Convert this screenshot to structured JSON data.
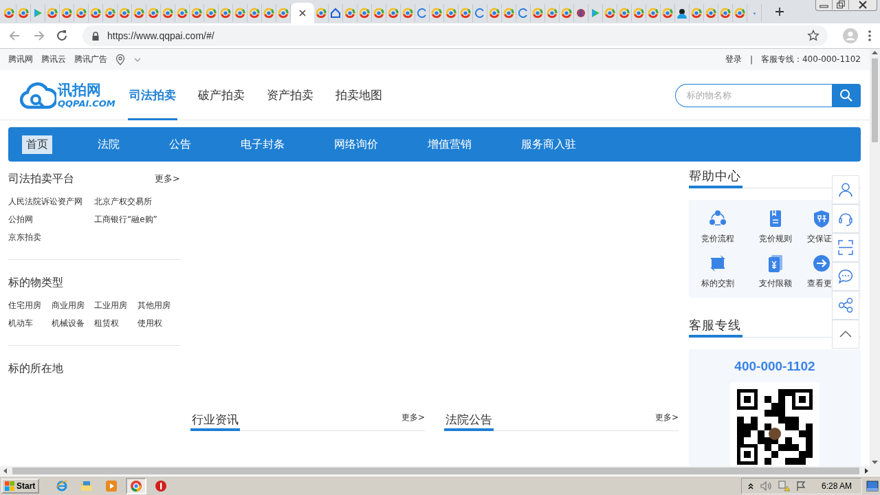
{
  "browser": {
    "tabs": [
      {
        "kind": "site",
        "selected": false
      },
      {
        "kind": "site",
        "selected": false
      },
      {
        "kind": "video",
        "selected": false
      },
      {
        "kind": "site",
        "selected": false
      },
      {
        "kind": "site",
        "selected": false
      },
      {
        "kind": "site",
        "selected": false
      },
      {
        "kind": "site",
        "selected": false
      },
      {
        "kind": "site",
        "selected": false
      },
      {
        "kind": "site",
        "selected": false
      },
      {
        "kind": "site",
        "selected": false
      },
      {
        "kind": "site",
        "selected": false
      },
      {
        "kind": "site",
        "selected": false
      },
      {
        "kind": "site",
        "selected": false
      },
      {
        "kind": "site",
        "selected": false
      },
      {
        "kind": "site",
        "selected": false
      },
      {
        "kind": "site",
        "selected": false
      },
      {
        "kind": "site",
        "selected": false
      },
      {
        "kind": "site",
        "selected": false
      },
      {
        "kind": "site",
        "selected": false
      },
      {
        "kind": "site",
        "selected": false
      },
      {
        "selected": true
      },
      {
        "kind": "site",
        "selected": false
      },
      {
        "kind": "home",
        "selected": false
      },
      {
        "kind": "site",
        "selected": false
      },
      {
        "kind": "site",
        "selected": false
      },
      {
        "kind": "site",
        "selected": false
      },
      {
        "kind": "site",
        "selected": false
      },
      {
        "kind": "site",
        "selected": false
      },
      {
        "kind": "loading",
        "selected": false
      },
      {
        "kind": "site",
        "selected": false
      },
      {
        "kind": "site",
        "selected": false
      },
      {
        "kind": "site",
        "selected": false
      },
      {
        "kind": "loading",
        "selected": false
      },
      {
        "kind": "site",
        "selected": false
      },
      {
        "kind": "site",
        "selected": false
      },
      {
        "kind": "loading",
        "selected": false
      },
      {
        "kind": "site",
        "selected": false
      },
      {
        "kind": "site",
        "selected": false
      },
      {
        "kind": "site",
        "selected": false
      },
      {
        "kind": "globe",
        "selected": false
      },
      {
        "kind": "video",
        "selected": false
      },
      {
        "kind": "site",
        "selected": false
      },
      {
        "kind": "site",
        "selected": false
      },
      {
        "kind": "site",
        "selected": false
      },
      {
        "kind": "site",
        "selected": false
      },
      {
        "kind": "site",
        "selected": false
      },
      {
        "kind": "avatar",
        "selected": false
      },
      {
        "kind": "site",
        "selected": false
      },
      {
        "kind": "site",
        "selected": false
      },
      {
        "kind": "site",
        "selected": false
      },
      {
        "kind": "site",
        "selected": false
      },
      {
        "kind": "blank",
        "selected": false
      }
    ],
    "address": "https://www.qqpai.com/#/"
  },
  "top_bar": {
    "links": [
      "腾讯网",
      "腾讯云",
      "腾讯广告"
    ],
    "login": "登录",
    "separator": "|",
    "hotline": "客服专线：400-000-1102"
  },
  "header": {
    "logo": {
      "name": "讯拍网",
      "domain": "QQPAI.COM"
    },
    "nav": [
      {
        "label": "司法拍卖",
        "selected": true
      },
      {
        "label": "破产拍卖",
        "selected": false
      },
      {
        "label": "资产拍卖",
        "selected": false
      },
      {
        "label": "拍卖地图",
        "selected": false
      }
    ],
    "search": {
      "placeholder": "标的物名称"
    }
  },
  "menu": [
    {
      "label": "首页",
      "selected": true
    },
    {
      "label": "法院",
      "selected": false
    },
    {
      "label": "公告",
      "selected": false
    },
    {
      "label": "电子封条",
      "selected": false
    },
    {
      "label": "网络询价",
      "selected": false
    },
    {
      "label": "增值营销",
      "selected": false
    },
    {
      "label": "服务商入驻",
      "selected": false
    }
  ],
  "left": [
    {
      "kind": "platforms",
      "title": "司法拍卖平台",
      "more": "更多>",
      "links": [
        "人民法院诉讼资产网",
        "北京产权交易所",
        "公拍网",
        "工商银行“融e购”",
        "京东拍卖"
      ]
    },
    {
      "kind": "categories",
      "title": "标的物类型",
      "links": [
        "住宅用房",
        "商业用房",
        "工业用房",
        "其他用房",
        "机动车",
        "机械设备",
        "租赁权",
        "使用权"
      ]
    },
    {
      "title": "标的所在地"
    }
  ],
  "news": [
    {
      "title": "行业资讯",
      "more": "更多>"
    },
    {
      "title": "法院公告",
      "more": "更多>"
    }
  ],
  "help": {
    "title": "帮助中心",
    "items": [
      {
        "kind": "flow",
        "label": "竞价流程"
      },
      {
        "kind": "rules",
        "label": "竞价规则"
      },
      {
        "kind": "deposit",
        "label": "交保证"
      },
      {
        "kind": "transfer",
        "label": "标的交割"
      },
      {
        "kind": "payment",
        "label": "支付限额"
      },
      {
        "kind": "more",
        "label": "查看更"
      }
    ]
  },
  "hotline": {
    "title": "客服专线",
    "phone": "400-000-1102"
  },
  "float_toolbar": [
    {
      "kind": "user"
    },
    {
      "kind": "headset"
    },
    {
      "kind": "scan"
    },
    {
      "kind": "chat"
    },
    {
      "kind": "share"
    },
    {
      "kind": "top"
    }
  ],
  "taskbar": {
    "start": "Start",
    "apps": [
      {
        "kind": "ie",
        "selected": false
      },
      {
        "kind": "folder",
        "selected": false
      },
      {
        "kind": "media",
        "selected": false
      },
      {
        "kind": "chrome",
        "selected": true
      },
      {
        "kind": "stop",
        "selected": false
      }
    ],
    "clock": "6:28 AM"
  }
}
